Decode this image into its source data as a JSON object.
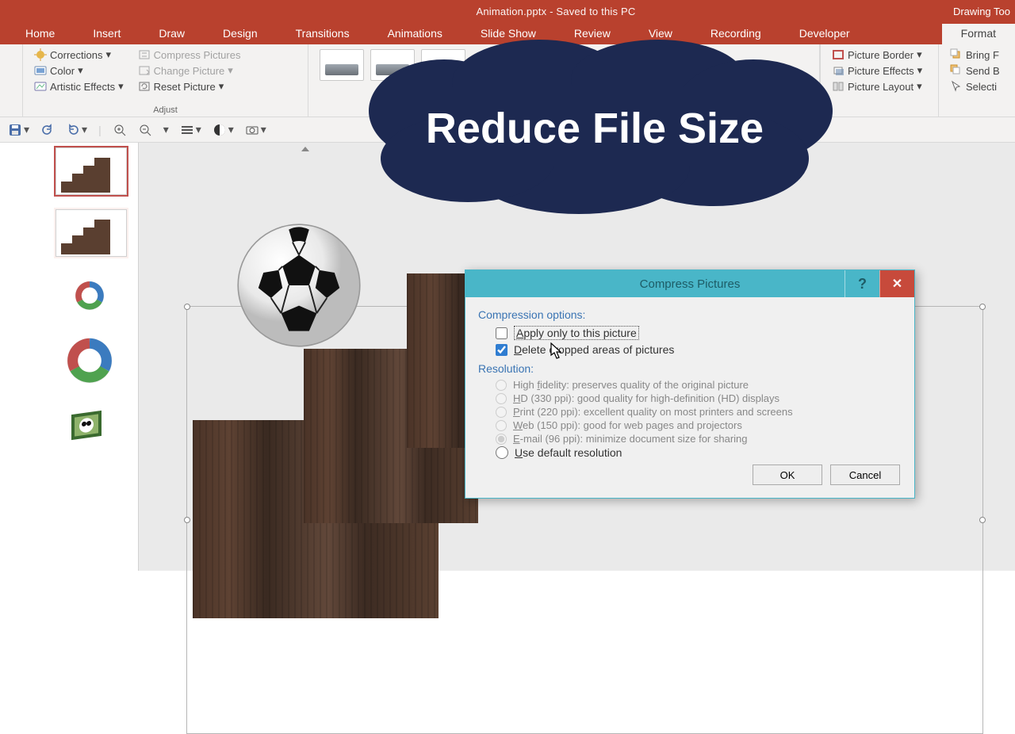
{
  "titlebar": {
    "title": "Animation.pptx  -  Saved to this PC",
    "drawing_tools": "Drawing Too"
  },
  "tabs": {
    "home": "Home",
    "insert": "Insert",
    "draw": "Draw",
    "design": "Design",
    "transitions": "Transitions",
    "animations": "Animations",
    "slideshow": "Slide Show",
    "review": "Review",
    "view": "View",
    "recording": "Recording",
    "developer": "Developer",
    "format": "Format"
  },
  "ribbon": {
    "adjust": {
      "corrections": "Corrections",
      "color": "Color",
      "artistic": "Artistic Effects",
      "compress": "Compress Pictures",
      "change": "Change Picture",
      "reset": "Reset Picture",
      "group_label": "Adjust"
    },
    "border": "Picture Border",
    "effects": "Picture Effects",
    "layout": "Picture Layout",
    "arrange": {
      "bringf": "Bring F",
      "sendb": "Send B",
      "selection": "Selecti"
    }
  },
  "dialog": {
    "title": "Compress Pictures",
    "section_compression": "Compression options:",
    "opt_apply": "Apply only to this picture",
    "opt_delete": "Delete cropped areas of pictures",
    "section_resolution": "Resolution:",
    "r_hf": "High fidelity: preserves quality of the original picture",
    "r_hd": "HD (330 ppi): good quality for high-definition (HD) displays",
    "r_print": "Print (220 ppi): excellent quality on most printers and screens",
    "r_web": "Web (150 ppi): good for web pages and projectors",
    "r_email": "E-mail (96 ppi): minimize document size for sharing",
    "r_default": "Use default resolution",
    "ok": "OK",
    "cancel": "Cancel",
    "help": "?",
    "close": "✕"
  },
  "callout": {
    "text": "Reduce File Size"
  }
}
